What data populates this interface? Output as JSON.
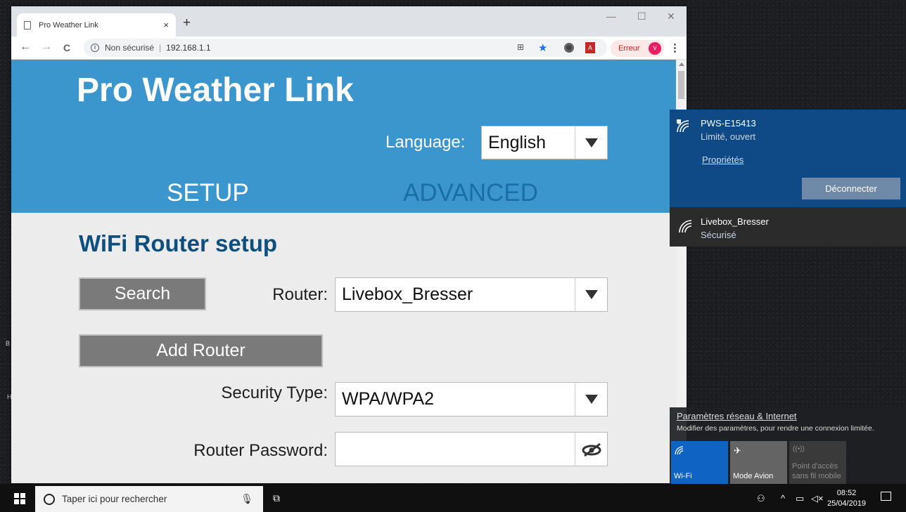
{
  "browser": {
    "tab_title": "Pro Weather Link",
    "tab_close": "×",
    "new_tab": "+",
    "win_minimize": "—",
    "win_maximize": "☐",
    "win_close": "✕",
    "nav_back": "←",
    "nav_forward": "→",
    "nav_reload": "C",
    "security_status": "Non sécurisé",
    "url": "192.168.1.1",
    "error_label": "Erreur",
    "profile_initial": "v",
    "menu": "⋮"
  },
  "page": {
    "site_title": "Pro Weather Link",
    "language_label": "Language:",
    "language_value": "English",
    "nav": {
      "setup": "SETUP",
      "advanced": "ADVANCED"
    },
    "section_title": "WiFi Router setup",
    "search_button": "Search",
    "router_label": "Router:",
    "router_value": "Livebox_Bresser",
    "add_router_button": "Add Router",
    "security_label": "Security Type:",
    "security_value": "WPA/WPA2",
    "password_label": "Router Password:",
    "password_value": "",
    "colors": {
      "header": "#3a96cc",
      "title": "#0e4f7d",
      "advanced": "#1b6fa6",
      "button": "#7a7a7a"
    }
  },
  "wifi_flyout": {
    "connected": {
      "name": "PWS-E15413",
      "status": "Limité, ouvert",
      "properties_link": "Propriétés",
      "disconnect_button": "Déconnecter"
    },
    "other": {
      "name": "Livebox_Bresser",
      "status": "Sécurisé"
    },
    "settings_link": "Paramètres réseau & Internet",
    "settings_desc": "Modifier des paramètres, pour rendre une connexion limitée.",
    "tiles": [
      {
        "label": "Wi-Fi",
        "state": "on",
        "icon": "wifi-icon"
      },
      {
        "label": "Mode Avion",
        "state": "off",
        "icon": "airplane-icon"
      },
      {
        "label": "Point d'accès sans fil mobile",
        "state": "disabled",
        "icon": "hotspot-icon"
      }
    ]
  },
  "taskbar": {
    "search_placeholder": "Taper ici pour rechercher",
    "time": "08:52",
    "date": "25/04/2019"
  }
}
